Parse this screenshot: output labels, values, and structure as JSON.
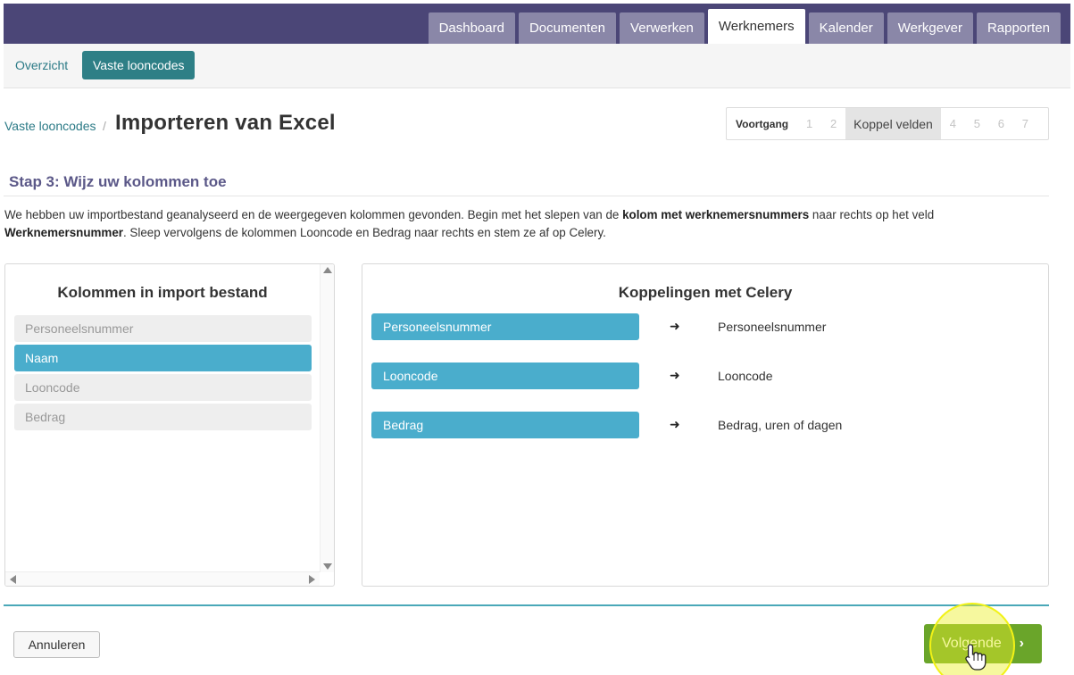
{
  "nav": {
    "tabs": [
      {
        "label": "Dashboard",
        "active": false
      },
      {
        "label": "Documenten",
        "active": false
      },
      {
        "label": "Verwerken",
        "active": false
      },
      {
        "label": "Werknemers",
        "active": true
      },
      {
        "label": "Kalender",
        "active": false
      },
      {
        "label": "Werkgever",
        "active": false
      },
      {
        "label": "Rapporten",
        "active": false
      }
    ]
  },
  "subnav": {
    "overview": "Overzicht",
    "active": "Vaste looncodes"
  },
  "breadcrumb": {
    "parent": "Vaste looncodes",
    "separator": "/",
    "title": "Importeren van Excel"
  },
  "progress": {
    "label": "Voortgang",
    "steps_before": [
      "1",
      "2"
    ],
    "current": "Koppel velden",
    "steps_after": [
      "4",
      "5",
      "6",
      "7"
    ]
  },
  "step": {
    "title": "Stap 3: Wijz uw kolommen toe",
    "intro_part1": "We hebben uw importbestand geanalyseerd en de weergegeven kolommen gevonden. Begin met het slepen van de ",
    "intro_bold1": "kolom met werknemersnummers",
    "intro_part2": " naar rechts op het veld ",
    "intro_bold2": "Werknemersnummer",
    "intro_part3": ". Sleep vervolgens de kolommen Looncode en Bedrag naar rechts en stem ze af op Celery."
  },
  "import_columns": {
    "title": "Kolommen in import bestand",
    "items": [
      {
        "label": "Personeelsnummer",
        "selected": false
      },
      {
        "label": "Naam",
        "selected": true
      },
      {
        "label": "Looncode",
        "selected": false
      },
      {
        "label": "Bedrag",
        "selected": false
      }
    ]
  },
  "mappings": {
    "title": "Koppelingen met Celery",
    "arrow": "➜",
    "rows": [
      {
        "source": "Personeelsnummer",
        "target": "Personeelsnummer"
      },
      {
        "source": "Looncode",
        "target": "Looncode"
      },
      {
        "source": "Bedrag",
        "target": "Bedrag, uren of dagen"
      }
    ]
  },
  "footer": {
    "cancel": "Annuleren",
    "next": "Volgende",
    "next_chevron": "›"
  },
  "colors": {
    "topbar": "#4b4677",
    "accent_teal": "#2e7f86",
    "selected_blue": "#4aadcc",
    "next_green": "#6aa52a"
  }
}
